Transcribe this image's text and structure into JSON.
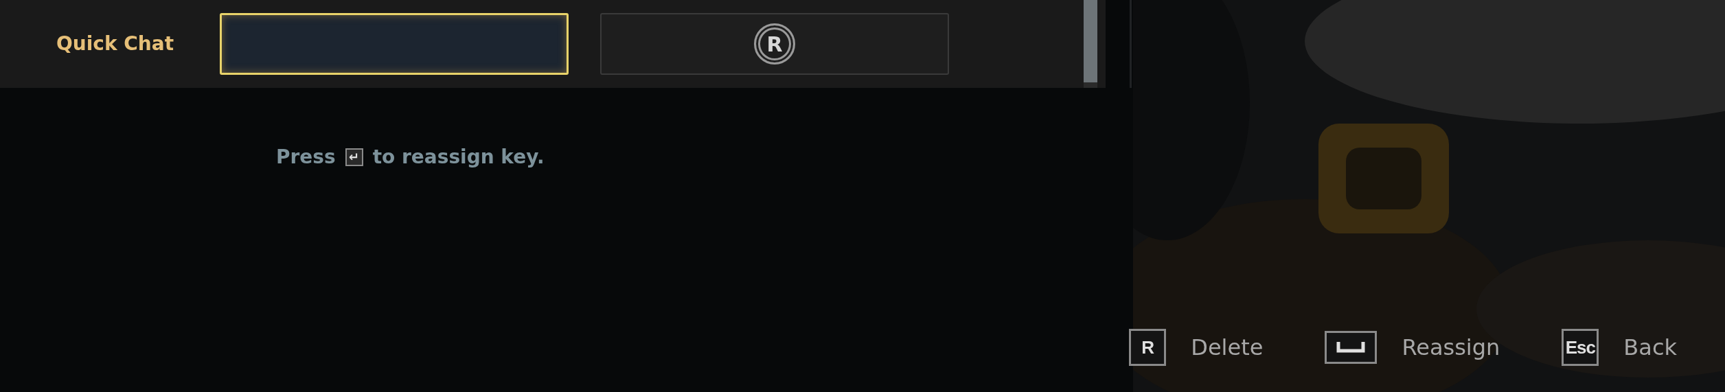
{
  "binding": {
    "label": "Quick Chat",
    "slots": [
      {
        "kind": "empty",
        "selected": true
      },
      {
        "kind": "key",
        "key": "R",
        "selected": false
      }
    ]
  },
  "hint": {
    "before": "Press",
    "key": "↵",
    "after": "to reassign key."
  },
  "footer": [
    {
      "kind": "text",
      "key": "R",
      "label": "Delete"
    },
    {
      "kind": "space",
      "label": "Reassign"
    },
    {
      "kind": "text",
      "key": "Esc",
      "label": "Back"
    }
  ]
}
